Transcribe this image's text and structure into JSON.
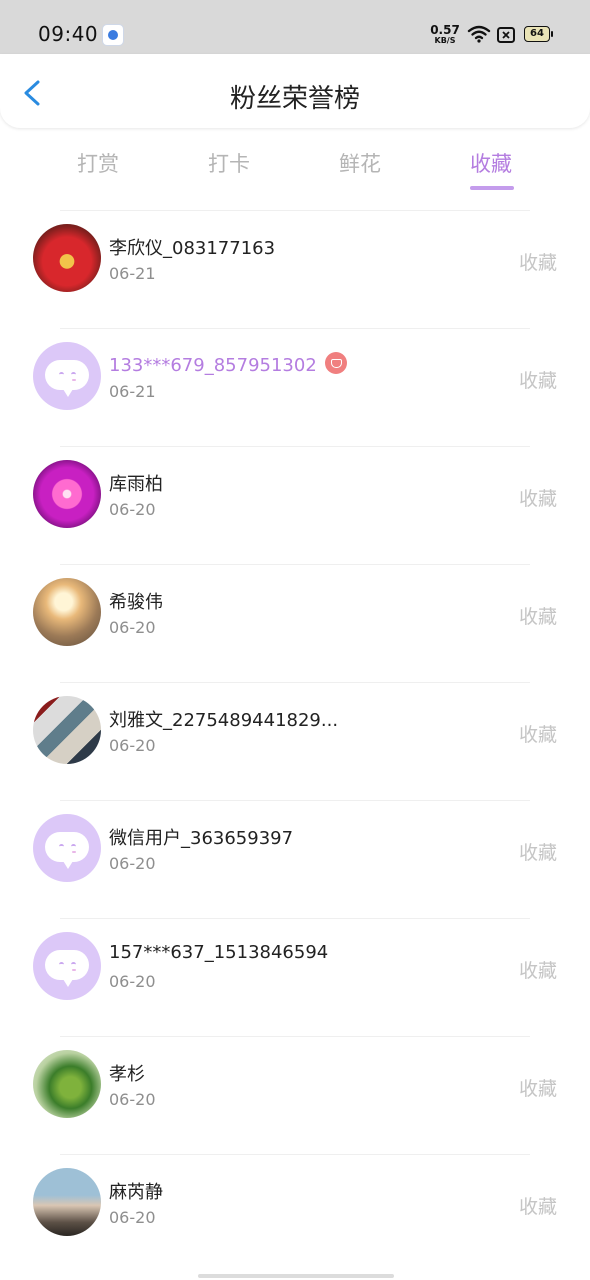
{
  "status_bar": {
    "time": "09:40",
    "net_speed": "0.57",
    "net_unit": "KB/S",
    "battery": "64"
  },
  "header": {
    "title": "粉丝荣誉榜"
  },
  "tabs": [
    {
      "label": "打赏"
    },
    {
      "label": "打卡"
    },
    {
      "label": "鲜花"
    },
    {
      "label": "收藏",
      "active": true
    }
  ],
  "colors": {
    "accent": "#b47de0",
    "default_avatar": "#dcc8f8",
    "back_arrow": "#2a8be0"
  },
  "list": [
    {
      "name": "李欣仪_083177163",
      "date": "06-21",
      "action": "收藏",
      "avatar": "photo"
    },
    {
      "name": "133***679_857951302",
      "date": "06-21",
      "action": "收藏",
      "avatar": "default",
      "vip": true
    },
    {
      "name": "库雨柏",
      "date": "06-20",
      "action": "收藏",
      "avatar": "photo"
    },
    {
      "name": "希骏伟",
      "date": "06-20",
      "action": "收藏",
      "avatar": "photo"
    },
    {
      "name": "刘雅文_2275489441829...",
      "date": "06-20",
      "action": "收藏",
      "avatar": "photo"
    },
    {
      "name": "微信用户_363659397",
      "date": "06-20",
      "action": "收藏",
      "avatar": "default"
    },
    {
      "name": "157***637_1513846594",
      "date": "06-20",
      "action": "收藏",
      "avatar": "default"
    },
    {
      "name": "孝杉",
      "date": "06-20",
      "action": "收藏",
      "avatar": "photo"
    },
    {
      "name": "麻芮静",
      "date": "06-20",
      "action": "收藏",
      "avatar": "photo"
    }
  ]
}
